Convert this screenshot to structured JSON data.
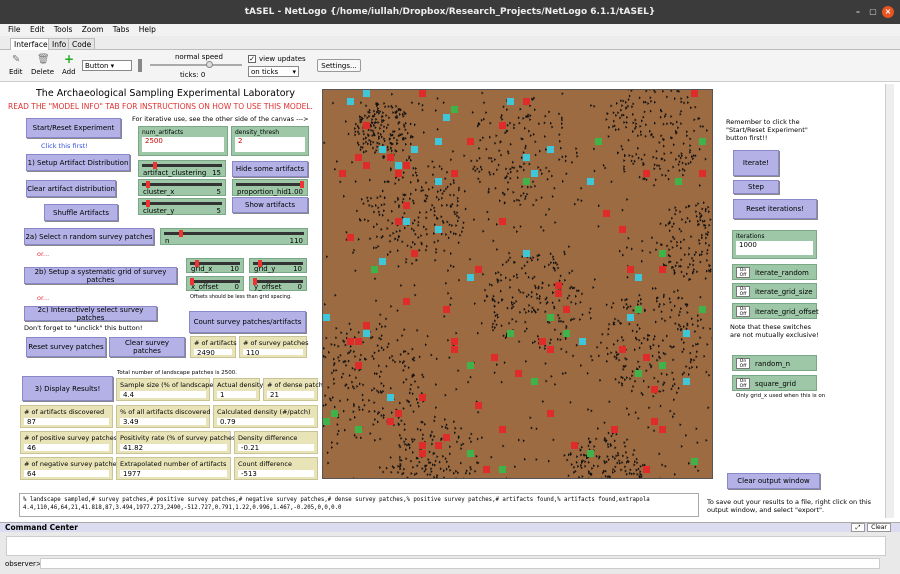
{
  "window": {
    "title": "tASEL - NetLogo {/home/iullah/Dropbox/Research_Projects/NetLogo 6.1.1/tASEL}"
  },
  "menu": [
    "File",
    "Edit",
    "Tools",
    "Zoom",
    "Tabs",
    "Help"
  ],
  "tabs": [
    "Interface",
    "Info",
    "Code"
  ],
  "toolbar": {
    "edit": "Edit",
    "delete": "Delete",
    "add": "Add",
    "widget_type": "Button",
    "speed_label": "normal speed",
    "ticks_label": "ticks: 0",
    "view_updates": "view updates",
    "update_mode": "on ticks",
    "settings": "Settings..."
  },
  "header": {
    "title": "The Archaeological Sampling Experimental Laboratory",
    "instructions": "READ THE \"MODEL INFO\" TAB FOR INSTRUCTIONS ON HOW TO USE THIS MODEL.",
    "iterative_note": "For iterative use, see the other side of the canvas --->"
  },
  "left": {
    "start_reset": "Start/Reset Experiment",
    "click_first": "Click this first!",
    "setup_artifacts": "1) Setup Artifact Distribution",
    "clear_artifacts": "Clear artifact distribution",
    "shuffle": "Shuffle Artifacts",
    "num_artifacts_label": "num_artifacts",
    "num_artifacts": "2500",
    "density_thresh_label": "density_thresh",
    "density_thresh": "2",
    "artifact_clustering_label": "artifact_clustering",
    "artifact_clustering": "15",
    "artifact_clustering_level": 0.15,
    "cluster_x_label": "cluster_x",
    "cluster_x": "5",
    "cluster_x_level": 0.05,
    "cluster_y_label": "cluster_y",
    "cluster_y": "5",
    "cluster_y_level": 0.05,
    "hide_some": "Hide some artifacts",
    "proportion_hid_label": "proportion_hid",
    "proportion_hid": "1.00",
    "proportion_hid_level": 1.0,
    "show_artifacts": "Show artifacts",
    "select_random": "2a) Select n random survey patches",
    "n_label": "n",
    "n_value": "110",
    "n_level": 0.11,
    "or1": "or...",
    "systematic": "2b) Setup a systematic grid of survey patches",
    "grid_x_label": "grid_x",
    "grid_x": "10",
    "grid_x_level": 0.1,
    "grid_y_label": "grid_y",
    "grid_y": "10",
    "grid_y_level": 0.1,
    "x_offset_label": "x_offset",
    "x_offset": "0",
    "x_offset_level": 0,
    "y_offset_label": "y_offset",
    "y_offset": "0",
    "y_offset_level": 0,
    "offset_note": "Offsets should be less than grid spacing.",
    "or2": "or...",
    "interactive": "2c) Interactively select survey patches",
    "unclick_note": "Don't forget to \"unclick\" this button!",
    "count_patches": "Count survey patches/artifacts",
    "reset_patches": "Reset survey patches",
    "clear_patches": "Clear survey patches",
    "num_artifacts_mon_label": "# of artifacts",
    "num_artifacts_mon": "2490",
    "num_survey_label": "# of survey patches",
    "num_survey": "110",
    "total_note": "Total number of landscape patches is 2500.",
    "display_results": "3) Display Results!"
  },
  "results": {
    "sample_size_label": "Sample size (% of landscape)",
    "sample_size": "4.4",
    "actual_density_label": "Actual density",
    "actual_density": "1",
    "dense_patches_label": "# of dense patches",
    "dense_patches": "21",
    "artifacts_discovered_label": "# of artifacts discovered",
    "artifacts_discovered": "87",
    "pct_artifacts_label": "% of all artifacts discovered",
    "pct_artifacts": "3.49",
    "calc_density_label": "Calculated density (#/patch)",
    "calc_density": "0.79",
    "positive_label": "# of positive survey patches",
    "positive": "46",
    "positivity_label": "Positivity rate (% of survey patches)",
    "positivity": "41.82",
    "density_diff_label": "Density difference",
    "density_diff": "-0.21",
    "negative_label": "# of negative survey patches",
    "negative": "64",
    "extrapolated_label": "Extrapolated number of artifacts",
    "extrapolated": "1977",
    "count_diff_label": "Count difference",
    "count_diff": "-513"
  },
  "right": {
    "remember": "Remember to click the \"Start/Reset Experiment\" button first!!",
    "iterate": "Iterate!",
    "step": "Step",
    "reset_iterations": "Reset iterations!",
    "iterations_label": "iterations",
    "iterations": "1000",
    "iterate_random": "iterate_random",
    "iterate_grid_size": "iterate_grid_size",
    "iterate_grid_offset": "iterate_grid_offset",
    "switch_note": "Note that these switches are not mutually exclusive!",
    "random_n": "random_n",
    "square_grid": "square_grid",
    "grid_note": "Only grid_x used when this is on",
    "clear_output": "Clear output window",
    "save_note": "To save out your results to a file, right click on this output window, and select \"export\".",
    "on": "On",
    "off": "Off"
  },
  "output": {
    "line1": "% landscape sampled,# survey patches,# positive survey patches,# negative survey patches,# dense survey patches,% positive survey patches,# artifacts found,% artifacts found,extrapola",
    "line2": "4.4,110,46,64,21,41.818,87,3.494,1977.273,2490,-512.727,0.791,1.22,0.996,1.467,-0.205,0,0,0.0"
  },
  "command": {
    "title": "Command Center",
    "clear": "Clear",
    "prompt": "observer>"
  },
  "colors": {
    "ground": "#9c6b42",
    "survey_red": "#e02b2b",
    "survey_green": "#3fb24a",
    "cyan": "#3fc6d8",
    "button": "#b3b1e5",
    "slider": "#9ec7a8",
    "monitor": "#e8e4b8"
  }
}
